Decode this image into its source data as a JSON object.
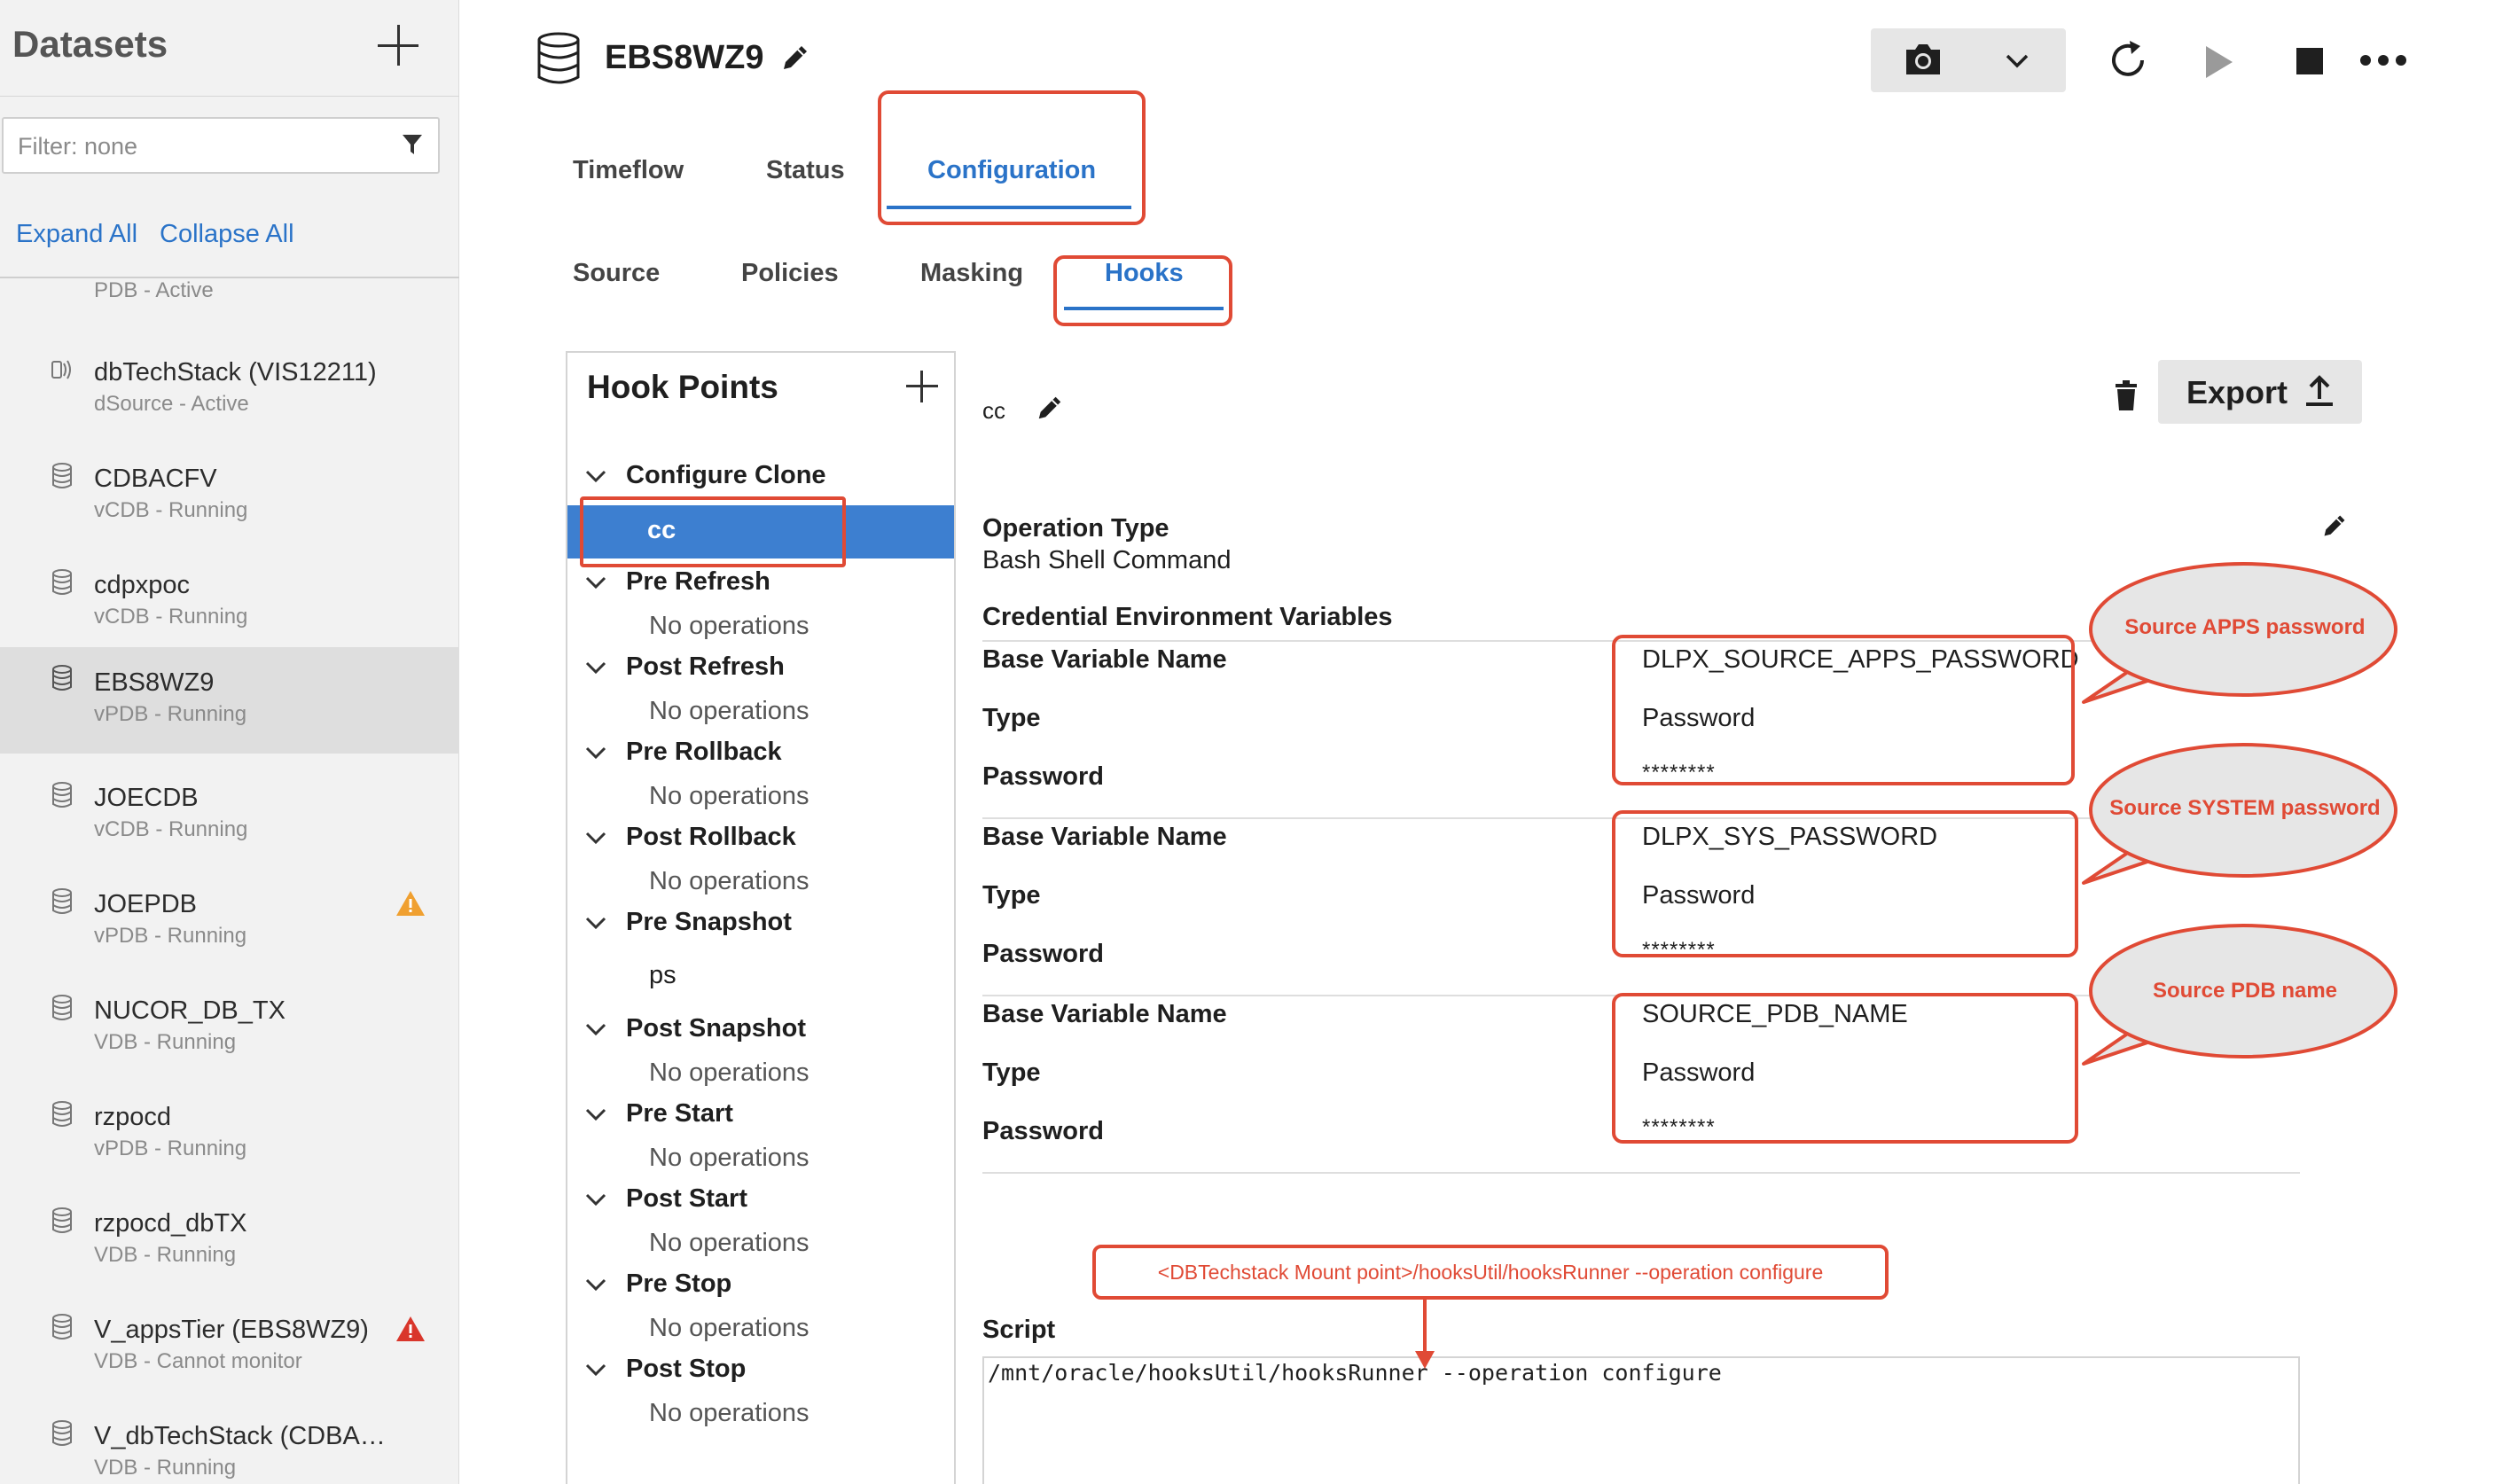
{
  "sidebar": {
    "title": "Datasets",
    "filter_placeholder": "Filter: none",
    "expand_all": "Expand All",
    "collapse_all": "Collapse All",
    "partial_item_status": "PDB - Active",
    "items": [
      {
        "name": "dbTechStack (VIS12211)",
        "status": "dSource - Active",
        "icon": "dsource-icon"
      },
      {
        "name": "CDBACFV",
        "status": "vCDB - Running",
        "icon": "database-icon"
      },
      {
        "name": "cdpxpoc",
        "status": "vCDB - Running",
        "icon": "database-icon"
      },
      {
        "name": "EBS8WZ9",
        "status": "vPDB - Running",
        "icon": "database-icon",
        "selected": true
      },
      {
        "name": "JOECDB",
        "status": "vCDB - Running",
        "icon": "database-icon"
      },
      {
        "name": "JOEPDB",
        "status": "vPDB - Running",
        "icon": "database-icon",
        "badge": "warning-icon",
        "badge_color": "#f0a030"
      },
      {
        "name": "NUCOR_DB_TX",
        "status": "VDB - Running",
        "icon": "database-icon"
      },
      {
        "name": "rzpocd",
        "status": "vPDB - Running",
        "icon": "database-icon"
      },
      {
        "name": "rzpocd_dbTX",
        "status": "VDB - Running",
        "icon": "database-icon"
      },
      {
        "name": "V_appsTier (EBS8WZ9)",
        "status": "VDB - Cannot monitor",
        "icon": "database-icon",
        "badge": "error-icon",
        "badge_color": "#d9362b"
      },
      {
        "name": "V_dbTechStack (CDBA…",
        "status": "VDB - Running",
        "icon": "database-icon"
      }
    ]
  },
  "header": {
    "title": "EBS8WZ9",
    "icons": [
      "database-icon",
      "pencil-icon",
      "camera-icon",
      "chevron-down-icon",
      "refresh-icon",
      "play-icon",
      "stop-icon",
      "more-icon"
    ]
  },
  "tabs": {
    "main": [
      "Timeflow",
      "Status",
      "Configuration"
    ],
    "main_selected": "Configuration",
    "sub": [
      "Source",
      "Policies",
      "Masking",
      "Hooks"
    ],
    "sub_selected": "Hooks"
  },
  "hook_points": {
    "title": "Hook Points",
    "groups": [
      {
        "name": "Configure Clone",
        "ops": [
          "cc"
        ],
        "selected_op": "cc"
      },
      {
        "name": "Pre Refresh",
        "ops": [
          "No operations"
        ]
      },
      {
        "name": "Post Refresh",
        "ops": [
          "No operations"
        ]
      },
      {
        "name": "Pre Rollback",
        "ops": [
          "No operations"
        ]
      },
      {
        "name": "Post Rollback",
        "ops": [
          "No operations"
        ]
      },
      {
        "name": "Pre Snapshot",
        "ops": [
          "ps"
        ]
      },
      {
        "name": "Post Snapshot",
        "ops": [
          "No operations"
        ]
      },
      {
        "name": "Pre Start",
        "ops": [
          "No operations"
        ]
      },
      {
        "name": "Post Start",
        "ops": [
          "No operations"
        ]
      },
      {
        "name": "Pre Stop",
        "ops": [
          "No operations"
        ]
      },
      {
        "name": "Post Stop",
        "ops": [
          "No operations"
        ]
      }
    ]
  },
  "detail": {
    "hook_name": "cc",
    "export_label": "Export",
    "operation_type_label": "Operation Type",
    "operation_type_value": "Bash Shell Command",
    "credentials_label": "Credential Environment Variables",
    "credentials": [
      {
        "base_label": "Base Variable Name",
        "base_value": "DLPX_SOURCE_APPS_PASSWORD",
        "type_label": "Type",
        "type_value": "Password",
        "password_label": "Password",
        "password_value": "********"
      },
      {
        "base_label": "Base Variable Name",
        "base_value": "DLPX_SYS_PASSWORD",
        "type_label": "Type",
        "type_value": "Password",
        "password_label": "Password",
        "password_value": "********"
      },
      {
        "base_label": "Base Variable Name",
        "base_value": "SOURCE_PDB_NAME",
        "type_label": "Type",
        "type_value": "Password",
        "password_label": "Password",
        "password_value": "********"
      }
    ],
    "script_label": "Script",
    "script_value": "/mnt/oracle/hooksUtil/hooksRunner --operation configure"
  },
  "annotations": {
    "color": "#e04a35",
    "callouts": [
      "Source APPS password",
      "Source SYSTEM password",
      "Source PDB name"
    ],
    "script_note": "<DBTechstack Mount point>/hooksUtil/hooksRunner --operation configure"
  },
  "colors": {
    "accent": "#2a73c8",
    "selected_row": "#3d7fd0",
    "annotation": "#e04a35"
  }
}
